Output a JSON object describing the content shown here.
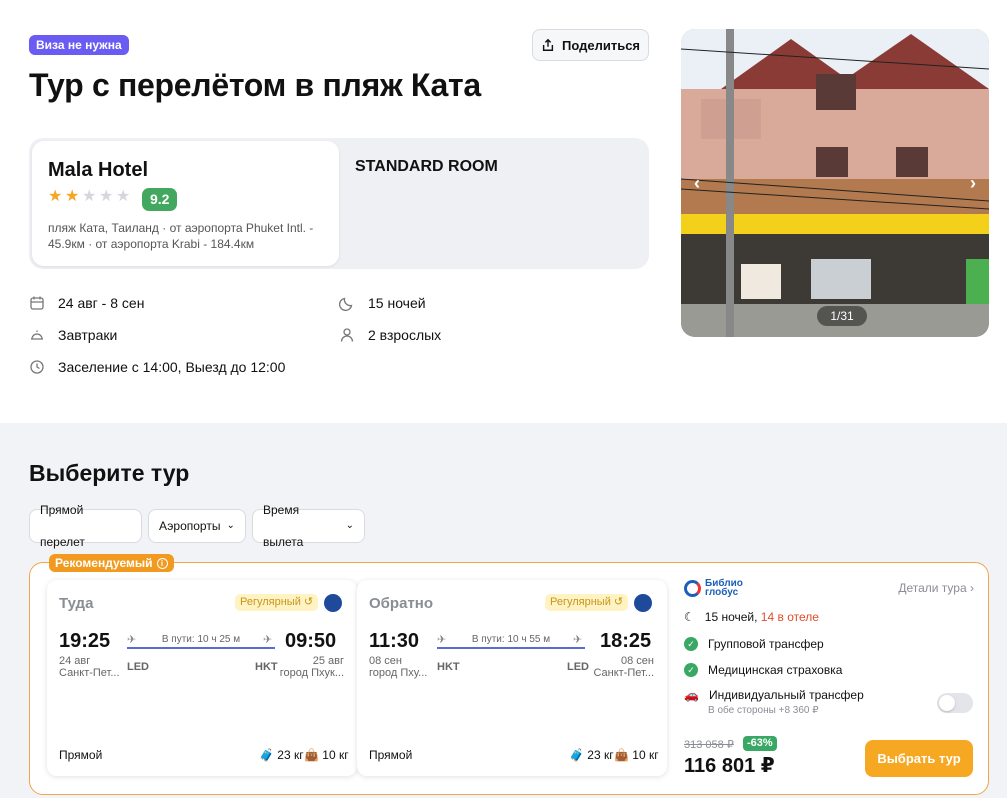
{
  "header": {
    "visa_badge": "Виза не нужна",
    "share_label": "Поделиться",
    "title": "Тур с перелётом в пляж Ката"
  },
  "hotel": {
    "name": "Mala Hotel",
    "stars": 2,
    "stars_max": 5,
    "rating": "9.2",
    "location": "пляж Ката, Таиланд · от аэропорта Phuket Intl. - 45.9км · от аэропорта Krabi - 184.4км",
    "room": "STANDARD ROOM"
  },
  "info": {
    "dates": "24 авг - 8 сен",
    "nights": "15 ночей",
    "meals": "Завтраки",
    "guests": "2 взрослых",
    "checkin": "Заселение с 14:00, Выезд до 12:00"
  },
  "gallery": {
    "counter": "1/31",
    "prev": "‹",
    "next": "›"
  },
  "section": {
    "title": "Выберите тур",
    "filters": [
      "Прямой перелет",
      "Аэропорты",
      "Время вылета"
    ]
  },
  "tour": {
    "recommended": "Рекомендуемый",
    "outbound": {
      "title": "Туда",
      "badge": "Регулярный",
      "dep_time": "19:25",
      "dep_date": "24 авг",
      "dep_city": "Санкт-Пет...",
      "duration": "В пути: 10 ч 25 м",
      "arr_time": "09:50",
      "arr_date": "25 авг",
      "arr_city": "город Пхук...",
      "dep_code": "LED",
      "arr_code": "HKT",
      "type": "Прямой",
      "bag1": "23 кг",
      "bag2": "10 кг"
    },
    "inbound": {
      "title": "Обратно",
      "badge": "Регулярный",
      "dep_time": "11:30",
      "dep_date": "08 сен",
      "dep_city": "город Пху...",
      "duration": "В пути: 10 ч 55 м",
      "arr_time": "18:25",
      "arr_date": "08 сен",
      "arr_city": "Санкт-Пет...",
      "dep_code": "HKT",
      "arr_code": "LED",
      "type": "Прямой",
      "bag1": "23 кг",
      "bag2": "10 кг"
    },
    "operator": {
      "logo_line1": "Библио",
      "logo_line2": "глобус",
      "details_link": "Детали тура"
    },
    "features": {
      "nights": "15 ночей,",
      "hotel_nights": "14 в отеле",
      "group_transfer": "Групповой трансфер",
      "insurance": "Медицинская страховка",
      "individual_transfer": "Индивидуальный трансфер",
      "individual_note": "В обе стороны +8 360 ₽"
    },
    "price": {
      "old": "313 058 ₽",
      "discount": "-63%",
      "current": "116 801 ₽",
      "button": "Выбрать тур"
    }
  },
  "colors": {
    "accent_purple": "#6a5bf2",
    "rating_green": "#42a85f",
    "orange": "#f7a823",
    "star": "#f5a623"
  }
}
